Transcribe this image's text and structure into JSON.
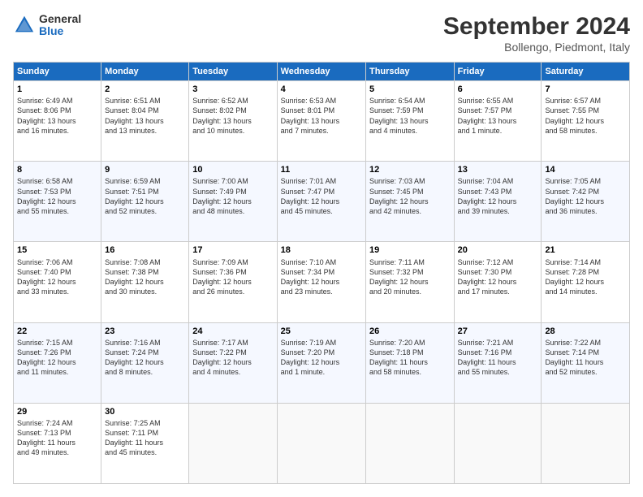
{
  "logo": {
    "general": "General",
    "blue": "Blue"
  },
  "title": "September 2024",
  "location": "Bollengo, Piedmont, Italy",
  "headers": [
    "Sunday",
    "Monday",
    "Tuesday",
    "Wednesday",
    "Thursday",
    "Friday",
    "Saturday"
  ],
  "weeks": [
    [
      {
        "day": "1",
        "detail": "Sunrise: 6:49 AM\nSunset: 8:06 PM\nDaylight: 13 hours\nand 16 minutes."
      },
      {
        "day": "2",
        "detail": "Sunrise: 6:51 AM\nSunset: 8:04 PM\nDaylight: 13 hours\nand 13 minutes."
      },
      {
        "day": "3",
        "detail": "Sunrise: 6:52 AM\nSunset: 8:02 PM\nDaylight: 13 hours\nand 10 minutes."
      },
      {
        "day": "4",
        "detail": "Sunrise: 6:53 AM\nSunset: 8:01 PM\nDaylight: 13 hours\nand 7 minutes."
      },
      {
        "day": "5",
        "detail": "Sunrise: 6:54 AM\nSunset: 7:59 PM\nDaylight: 13 hours\nand 4 minutes."
      },
      {
        "day": "6",
        "detail": "Sunrise: 6:55 AM\nSunset: 7:57 PM\nDaylight: 13 hours\nand 1 minute."
      },
      {
        "day": "7",
        "detail": "Sunrise: 6:57 AM\nSunset: 7:55 PM\nDaylight: 12 hours\nand 58 minutes."
      }
    ],
    [
      {
        "day": "8",
        "detail": "Sunrise: 6:58 AM\nSunset: 7:53 PM\nDaylight: 12 hours\nand 55 minutes."
      },
      {
        "day": "9",
        "detail": "Sunrise: 6:59 AM\nSunset: 7:51 PM\nDaylight: 12 hours\nand 52 minutes."
      },
      {
        "day": "10",
        "detail": "Sunrise: 7:00 AM\nSunset: 7:49 PM\nDaylight: 12 hours\nand 48 minutes."
      },
      {
        "day": "11",
        "detail": "Sunrise: 7:01 AM\nSunset: 7:47 PM\nDaylight: 12 hours\nand 45 minutes."
      },
      {
        "day": "12",
        "detail": "Sunrise: 7:03 AM\nSunset: 7:45 PM\nDaylight: 12 hours\nand 42 minutes."
      },
      {
        "day": "13",
        "detail": "Sunrise: 7:04 AM\nSunset: 7:43 PM\nDaylight: 12 hours\nand 39 minutes."
      },
      {
        "day": "14",
        "detail": "Sunrise: 7:05 AM\nSunset: 7:42 PM\nDaylight: 12 hours\nand 36 minutes."
      }
    ],
    [
      {
        "day": "15",
        "detail": "Sunrise: 7:06 AM\nSunset: 7:40 PM\nDaylight: 12 hours\nand 33 minutes."
      },
      {
        "day": "16",
        "detail": "Sunrise: 7:08 AM\nSunset: 7:38 PM\nDaylight: 12 hours\nand 30 minutes."
      },
      {
        "day": "17",
        "detail": "Sunrise: 7:09 AM\nSunset: 7:36 PM\nDaylight: 12 hours\nand 26 minutes."
      },
      {
        "day": "18",
        "detail": "Sunrise: 7:10 AM\nSunset: 7:34 PM\nDaylight: 12 hours\nand 23 minutes."
      },
      {
        "day": "19",
        "detail": "Sunrise: 7:11 AM\nSunset: 7:32 PM\nDaylight: 12 hours\nand 20 minutes."
      },
      {
        "day": "20",
        "detail": "Sunrise: 7:12 AM\nSunset: 7:30 PM\nDaylight: 12 hours\nand 17 minutes."
      },
      {
        "day": "21",
        "detail": "Sunrise: 7:14 AM\nSunset: 7:28 PM\nDaylight: 12 hours\nand 14 minutes."
      }
    ],
    [
      {
        "day": "22",
        "detail": "Sunrise: 7:15 AM\nSunset: 7:26 PM\nDaylight: 12 hours\nand 11 minutes."
      },
      {
        "day": "23",
        "detail": "Sunrise: 7:16 AM\nSunset: 7:24 PM\nDaylight: 12 hours\nand 8 minutes."
      },
      {
        "day": "24",
        "detail": "Sunrise: 7:17 AM\nSunset: 7:22 PM\nDaylight: 12 hours\nand 4 minutes."
      },
      {
        "day": "25",
        "detail": "Sunrise: 7:19 AM\nSunset: 7:20 PM\nDaylight: 12 hours\nand 1 minute."
      },
      {
        "day": "26",
        "detail": "Sunrise: 7:20 AM\nSunset: 7:18 PM\nDaylight: 11 hours\nand 58 minutes."
      },
      {
        "day": "27",
        "detail": "Sunrise: 7:21 AM\nSunset: 7:16 PM\nDaylight: 11 hours\nand 55 minutes."
      },
      {
        "day": "28",
        "detail": "Sunrise: 7:22 AM\nSunset: 7:14 PM\nDaylight: 11 hours\nand 52 minutes."
      }
    ],
    [
      {
        "day": "29",
        "detail": "Sunrise: 7:24 AM\nSunset: 7:13 PM\nDaylight: 11 hours\nand 49 minutes."
      },
      {
        "day": "30",
        "detail": "Sunrise: 7:25 AM\nSunset: 7:11 PM\nDaylight: 11 hours\nand 45 minutes."
      },
      {
        "day": "",
        "detail": ""
      },
      {
        "day": "",
        "detail": ""
      },
      {
        "day": "",
        "detail": ""
      },
      {
        "day": "",
        "detail": ""
      },
      {
        "day": "",
        "detail": ""
      }
    ]
  ]
}
